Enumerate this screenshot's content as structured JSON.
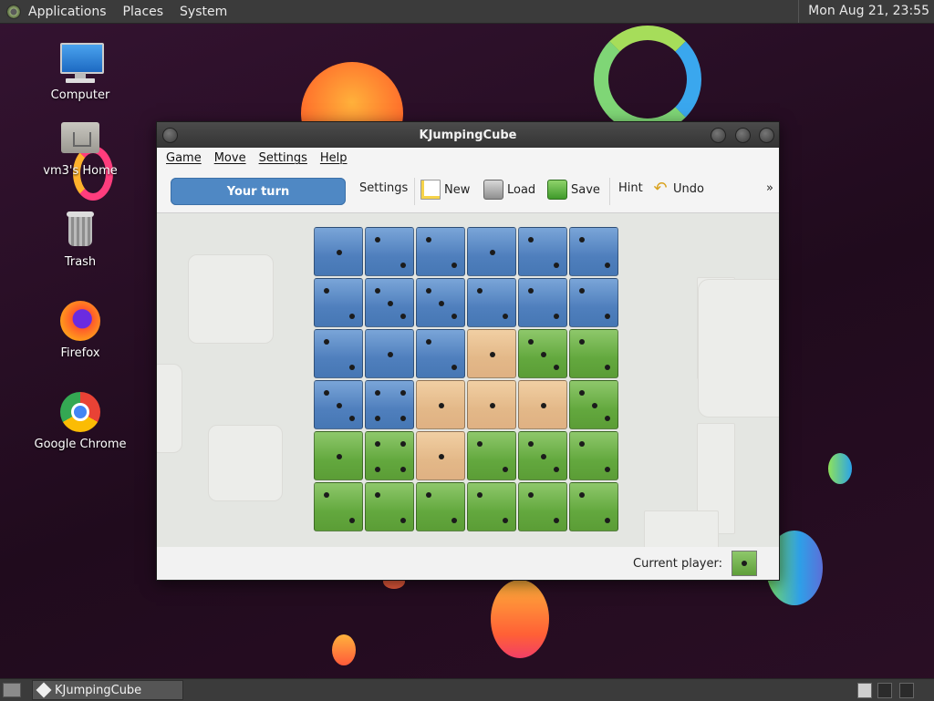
{
  "top_panel": {
    "menus": [
      "Applications",
      "Places",
      "System"
    ],
    "clock": "Mon Aug 21, 23:55"
  },
  "desktop": {
    "icons": [
      {
        "label": "Computer",
        "icon": "computer-icon"
      },
      {
        "label": "vm3's Home",
        "icon": "home-folder-icon"
      },
      {
        "label": "Trash",
        "icon": "trash-icon"
      },
      {
        "label": "Firefox",
        "icon": "firefox-icon"
      },
      {
        "label": "Google Chrome",
        "icon": "chrome-icon"
      }
    ]
  },
  "window": {
    "title": "KJumpingCube",
    "menu": [
      "Game",
      "Move",
      "Settings",
      "Help"
    ],
    "toolbar": {
      "turn": "Your turn",
      "settings": "Settings",
      "new": "New",
      "load": "Load",
      "save": "Save",
      "hint": "Hint",
      "undo": "Undo",
      "overflow": "»"
    },
    "status": {
      "current_player_label": "Current player:",
      "current_player_color": "green",
      "current_player_value": 1
    }
  },
  "board": {
    "size": 6,
    "rows": [
      [
        {
          "c": "blue",
          "v": 1
        },
        {
          "c": "blue",
          "v": 2
        },
        {
          "c": "blue",
          "v": 2
        },
        {
          "c": "blue",
          "v": 1
        },
        {
          "c": "blue",
          "v": 2
        },
        {
          "c": "blue",
          "v": 2
        }
      ],
      [
        {
          "c": "blue",
          "v": 2
        },
        {
          "c": "blue",
          "v": 3
        },
        {
          "c": "blue",
          "v": 3
        },
        {
          "c": "blue",
          "v": 2
        },
        {
          "c": "blue",
          "v": 2
        },
        {
          "c": "blue",
          "v": 2
        }
      ],
      [
        {
          "c": "blue",
          "v": 2
        },
        {
          "c": "blue",
          "v": 1
        },
        {
          "c": "blue",
          "v": 2
        },
        {
          "c": "tan",
          "v": 1
        },
        {
          "c": "green",
          "v": 3
        },
        {
          "c": "green",
          "v": 2
        }
      ],
      [
        {
          "c": "blue",
          "v": 3
        },
        {
          "c": "blue",
          "v": 4
        },
        {
          "c": "tan",
          "v": 1
        },
        {
          "c": "tan",
          "v": 1
        },
        {
          "c": "tan",
          "v": 1
        },
        {
          "c": "green",
          "v": 3
        }
      ],
      [
        {
          "c": "green",
          "v": 1
        },
        {
          "c": "green",
          "v": 4
        },
        {
          "c": "tan",
          "v": 1
        },
        {
          "c": "green",
          "v": 2
        },
        {
          "c": "green",
          "v": 3
        },
        {
          "c": "green",
          "v": 2
        }
      ],
      [
        {
          "c": "green",
          "v": 2
        },
        {
          "c": "green",
          "v": 2
        },
        {
          "c": "green",
          "v": 2
        },
        {
          "c": "green",
          "v": 2
        },
        {
          "c": "green",
          "v": 2
        },
        {
          "c": "green",
          "v": 2
        }
      ]
    ]
  },
  "taskbar": {
    "tasks": [
      {
        "label": "KJumpingCube",
        "icon": "kjumpingcube-icon"
      }
    ]
  },
  "colors": {
    "blue": "#4f7fbd",
    "green": "#63a83e",
    "tan": "#e3b888",
    "accent": "#4f88c4"
  }
}
